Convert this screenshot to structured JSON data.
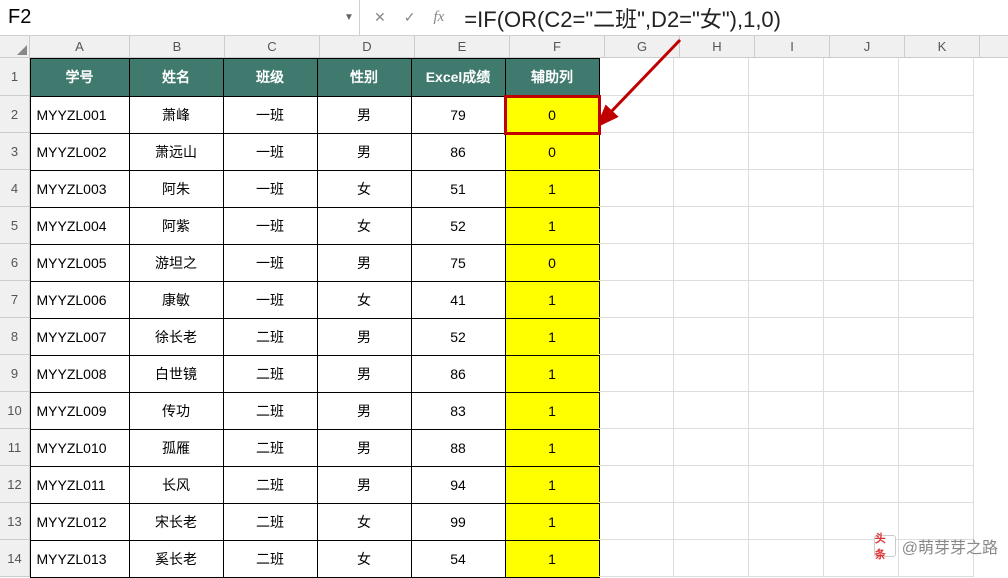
{
  "nameBox": "F2",
  "formula": "=IF(OR(C2=\"二班\",D2=\"女\"),1,0)",
  "columns": [
    "A",
    "B",
    "C",
    "D",
    "E",
    "F",
    "G",
    "H",
    "I",
    "J",
    "K"
  ],
  "headers": [
    "学号",
    "姓名",
    "班级",
    "性别",
    "Excel成绩",
    "辅助列"
  ],
  "rows": [
    {
      "n": "1"
    },
    {
      "n": "2",
      "id": "MYYZL001",
      "name": "萧峰",
      "class": "一班",
      "gender": "男",
      "score": "79",
      "aux": "0"
    },
    {
      "n": "3",
      "id": "MYYZL002",
      "name": "萧远山",
      "class": "一班",
      "gender": "男",
      "score": "86",
      "aux": "0"
    },
    {
      "n": "4",
      "id": "MYYZL003",
      "name": "阿朱",
      "class": "一班",
      "gender": "女",
      "score": "51",
      "aux": "1"
    },
    {
      "n": "5",
      "id": "MYYZL004",
      "name": "阿紫",
      "class": "一班",
      "gender": "女",
      "score": "52",
      "aux": "1"
    },
    {
      "n": "6",
      "id": "MYYZL005",
      "name": "游坦之",
      "class": "一班",
      "gender": "男",
      "score": "75",
      "aux": "0"
    },
    {
      "n": "7",
      "id": "MYYZL006",
      "name": "康敏",
      "class": "一班",
      "gender": "女",
      "score": "41",
      "aux": "1"
    },
    {
      "n": "8",
      "id": "MYYZL007",
      "name": "徐长老",
      "class": "二班",
      "gender": "男",
      "score": "52",
      "aux": "1"
    },
    {
      "n": "9",
      "id": "MYYZL008",
      "name": "白世镜",
      "class": "二班",
      "gender": "男",
      "score": "86",
      "aux": "1"
    },
    {
      "n": "10",
      "id": "MYYZL009",
      "name": "传功",
      "class": "二班",
      "gender": "男",
      "score": "83",
      "aux": "1"
    },
    {
      "n": "11",
      "id": "MYYZL010",
      "name": "孤雁",
      "class": "二班",
      "gender": "男",
      "score": "88",
      "aux": "1"
    },
    {
      "n": "12",
      "id": "MYYZL011",
      "name": "长风",
      "class": "二班",
      "gender": "男",
      "score": "94",
      "aux": "1"
    },
    {
      "n": "13",
      "id": "MYYZL012",
      "name": "宋长老",
      "class": "二班",
      "gender": "女",
      "score": "99",
      "aux": "1"
    },
    {
      "n": "14",
      "id": "MYYZL013",
      "name": "奚长老",
      "class": "二班",
      "gender": "女",
      "score": "54",
      "aux": "1"
    }
  ],
  "watermark": {
    "logo": "头条",
    "text": "@萌芽芽之路"
  }
}
